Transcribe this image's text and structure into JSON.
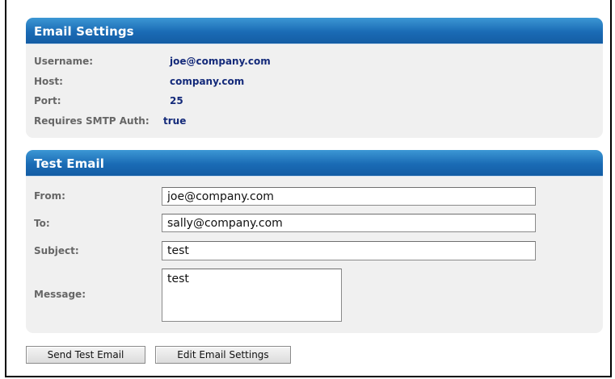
{
  "email_settings": {
    "title": "Email Settings",
    "rows": [
      {
        "label": "Username:",
        "value": "joe@company.com"
      },
      {
        "label": "Host:",
        "value": "company.com"
      },
      {
        "label": "Port:",
        "value": "25"
      },
      {
        "label": "Requires SMTP Auth:",
        "value": "true"
      }
    ]
  },
  "test_email": {
    "title": "Test Email",
    "from": {
      "label": "From:",
      "value": "joe@company.com"
    },
    "to": {
      "label": "To:",
      "value": "sally@company.com"
    },
    "subject": {
      "label": "Subject:",
      "value": "test"
    },
    "message": {
      "label": "Message:",
      "value": "test"
    }
  },
  "buttons": {
    "send": "Send Test Email",
    "edit": "Edit Email Settings"
  }
}
